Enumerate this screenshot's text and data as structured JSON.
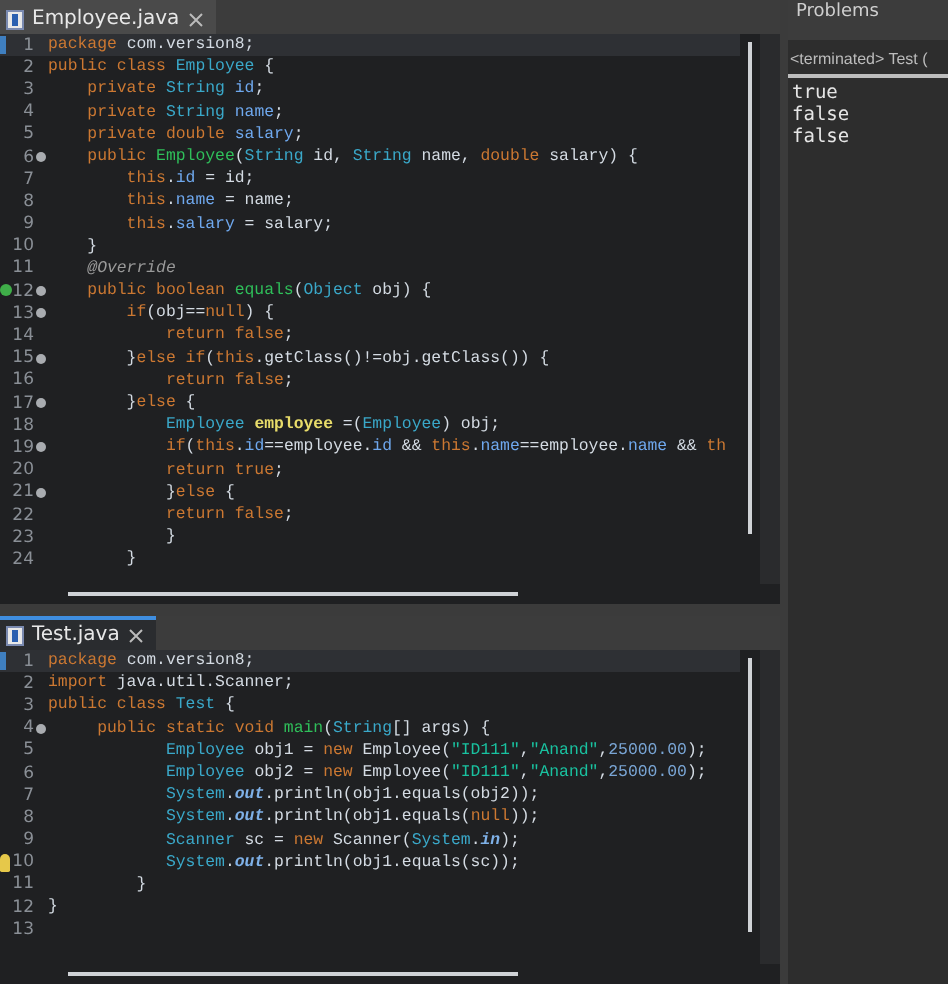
{
  "editors": [
    {
      "tab": {
        "title": "Employee.java",
        "selected": false
      },
      "lines": [
        {
          "number": "1",
          "current": true,
          "fold": false,
          "tokens": [
            {
              "kind": "kw",
              "text": "package"
            },
            {
              "kind": "plain",
              "text": " com.version8;"
            }
          ]
        },
        {
          "number": "2",
          "current": false,
          "fold": false,
          "tokens": [
            {
              "kind": "kw",
              "text": "public class "
            },
            {
              "kind": "type",
              "text": "Employee"
            },
            {
              "kind": "plain",
              "text": " {"
            }
          ]
        },
        {
          "number": "3",
          "current": false,
          "fold": false,
          "tokens": [
            {
              "kind": "kw",
              "text": "    private "
            },
            {
              "kind": "type",
              "text": "String "
            },
            {
              "kind": "field",
              "text": "id"
            },
            {
              "kind": "plain",
              "text": ";"
            }
          ]
        },
        {
          "number": "4",
          "current": false,
          "fold": false,
          "tokens": [
            {
              "kind": "kw",
              "text": "    private "
            },
            {
              "kind": "type",
              "text": "String "
            },
            {
              "kind": "field",
              "text": "name"
            },
            {
              "kind": "plain",
              "text": ";"
            }
          ]
        },
        {
          "number": "5",
          "current": false,
          "fold": false,
          "tokens": [
            {
              "kind": "kw",
              "text": "    private double "
            },
            {
              "kind": "field",
              "text": "salary"
            },
            {
              "kind": "plain",
              "text": ";"
            }
          ]
        },
        {
          "number": "6",
          "current": false,
          "fold": true,
          "tokens": [
            {
              "kind": "kw",
              "text": "    public "
            },
            {
              "kind": "method",
              "text": "Employee"
            },
            {
              "kind": "plain",
              "text": "("
            },
            {
              "kind": "type",
              "text": "String"
            },
            {
              "kind": "plain",
              "text": " id, "
            },
            {
              "kind": "type",
              "text": "String"
            },
            {
              "kind": "plain",
              "text": " name, "
            },
            {
              "kind": "kw",
              "text": "double"
            },
            {
              "kind": "plain",
              "text": " salary) {"
            }
          ]
        },
        {
          "number": "7",
          "current": false,
          "fold": false,
          "tokens": [
            {
              "kind": "kw",
              "text": "        this"
            },
            {
              "kind": "plain",
              "text": "."
            },
            {
              "kind": "field",
              "text": "id"
            },
            {
              "kind": "plain",
              "text": " = id;"
            }
          ]
        },
        {
          "number": "8",
          "current": false,
          "fold": false,
          "tokens": [
            {
              "kind": "kw",
              "text": "        this"
            },
            {
              "kind": "plain",
              "text": "."
            },
            {
              "kind": "field",
              "text": "name"
            },
            {
              "kind": "plain",
              "text": " = name;"
            }
          ]
        },
        {
          "number": "9",
          "current": false,
          "fold": false,
          "tokens": [
            {
              "kind": "kw",
              "text": "        this"
            },
            {
              "kind": "plain",
              "text": "."
            },
            {
              "kind": "field",
              "text": "salary"
            },
            {
              "kind": "plain",
              "text": " = salary;"
            }
          ]
        },
        {
          "number": "10",
          "current": false,
          "fold": false,
          "tokens": [
            {
              "kind": "plain",
              "text": "    }"
            }
          ]
        },
        {
          "number": "11",
          "current": false,
          "fold": false,
          "tokens": [
            {
              "kind": "ann",
              "text": "    @Override"
            }
          ]
        },
        {
          "number": "12",
          "current": false,
          "fold": true,
          "override": true,
          "tokens": [
            {
              "kind": "kw",
              "text": "    public boolean "
            },
            {
              "kind": "method",
              "text": "equals"
            },
            {
              "kind": "plain",
              "text": "("
            },
            {
              "kind": "type",
              "text": "Object"
            },
            {
              "kind": "plain",
              "text": " obj) {"
            }
          ]
        },
        {
          "number": "13",
          "current": false,
          "fold": true,
          "tokens": [
            {
              "kind": "kw",
              "text": "        if"
            },
            {
              "kind": "plain",
              "text": "(obj=="
            },
            {
              "kind": "kw",
              "text": "null"
            },
            {
              "kind": "plain",
              "text": ") {"
            }
          ]
        },
        {
          "number": "14",
          "current": false,
          "fold": false,
          "tokens": [
            {
              "kind": "kw",
              "text": "            return false"
            },
            {
              "kind": "plain",
              "text": ";"
            }
          ]
        },
        {
          "number": "15",
          "current": false,
          "fold": true,
          "tokens": [
            {
              "kind": "plain",
              "text": "        }"
            },
            {
              "kind": "kw",
              "text": "else if"
            },
            {
              "kind": "plain",
              "text": "("
            },
            {
              "kind": "kw",
              "text": "this"
            },
            {
              "kind": "plain",
              "text": ".getClass()!=obj.getClass()) {"
            }
          ]
        },
        {
          "number": "16",
          "current": false,
          "fold": false,
          "tokens": [
            {
              "kind": "kw",
              "text": "            return false"
            },
            {
              "kind": "plain",
              "text": ";"
            }
          ]
        },
        {
          "number": "17",
          "current": false,
          "fold": true,
          "tokens": [
            {
              "kind": "plain",
              "text": "        }"
            },
            {
              "kind": "kw",
              "text": "else"
            },
            {
              "kind": "plain",
              "text": " {"
            }
          ]
        },
        {
          "number": "18",
          "current": false,
          "fold": false,
          "tokens": [
            {
              "kind": "type",
              "text": "            Employee"
            },
            {
              "kind": "local",
              "text": " employee"
            },
            {
              "kind": "plain",
              "text": " =("
            },
            {
              "kind": "type",
              "text": "Employee"
            },
            {
              "kind": "plain",
              "text": ") obj;"
            }
          ]
        },
        {
          "number": "19",
          "current": false,
          "fold": true,
          "tokens": [
            {
              "kind": "kw",
              "text": "            if"
            },
            {
              "kind": "plain",
              "text": "("
            },
            {
              "kind": "kw",
              "text": "this"
            },
            {
              "kind": "plain",
              "text": "."
            },
            {
              "kind": "field",
              "text": "id"
            },
            {
              "kind": "plain",
              "text": "==employee."
            },
            {
              "kind": "field",
              "text": "id"
            },
            {
              "kind": "plain",
              "text": " && "
            },
            {
              "kind": "kw",
              "text": "this"
            },
            {
              "kind": "plain",
              "text": "."
            },
            {
              "kind": "field",
              "text": "name"
            },
            {
              "kind": "plain",
              "text": "==employee."
            },
            {
              "kind": "field",
              "text": "name"
            },
            {
              "kind": "plain",
              "text": " && "
            },
            {
              "kind": "kw",
              "text": "th"
            }
          ]
        },
        {
          "number": "20",
          "current": false,
          "fold": false,
          "tokens": [
            {
              "kind": "kw",
              "text": "            return true"
            },
            {
              "kind": "plain",
              "text": ";"
            }
          ]
        },
        {
          "number": "21",
          "current": false,
          "fold": true,
          "tokens": [
            {
              "kind": "plain",
              "text": "            }"
            },
            {
              "kind": "kw",
              "text": "else"
            },
            {
              "kind": "plain",
              "text": " {"
            }
          ]
        },
        {
          "number": "22",
          "current": false,
          "fold": false,
          "tokens": [
            {
              "kind": "kw",
              "text": "            return false"
            },
            {
              "kind": "plain",
              "text": ";"
            }
          ]
        },
        {
          "number": "23",
          "current": false,
          "fold": false,
          "tokens": [
            {
              "kind": "plain",
              "text": "            }"
            }
          ]
        },
        {
          "number": "24",
          "current": false,
          "fold": false,
          "tokens": [
            {
              "kind": "plain",
              "text": "        }"
            }
          ]
        }
      ]
    },
    {
      "tab": {
        "title": "Test.java",
        "selected": true
      },
      "lines": [
        {
          "number": "1",
          "current": true,
          "fold": false,
          "tokens": [
            {
              "kind": "kw",
              "text": "package"
            },
            {
              "kind": "plain",
              "text": " com.version8;"
            }
          ]
        },
        {
          "number": "2",
          "current": false,
          "fold": false,
          "tokens": [
            {
              "kind": "kw",
              "text": "import"
            },
            {
              "kind": "plain",
              "text": " java.util.Scanner;"
            }
          ]
        },
        {
          "number": "3",
          "current": false,
          "fold": false,
          "tokens": [
            {
              "kind": "kw",
              "text": "public class "
            },
            {
              "kind": "type",
              "text": "Test"
            },
            {
              "kind": "plain",
              "text": " {"
            }
          ]
        },
        {
          "number": "4",
          "current": false,
          "fold": true,
          "tokens": [
            {
              "kind": "kw",
              "text": "     public static void "
            },
            {
              "kind": "method",
              "text": "main"
            },
            {
              "kind": "plain",
              "text": "("
            },
            {
              "kind": "type",
              "text": "String"
            },
            {
              "kind": "plain",
              "text": "[] args) {"
            }
          ]
        },
        {
          "number": "5",
          "current": false,
          "fold": false,
          "tokens": [
            {
              "kind": "type",
              "text": "            Employee"
            },
            {
              "kind": "plain",
              "text": " obj1 = "
            },
            {
              "kind": "kw",
              "text": "new"
            },
            {
              "kind": "plain",
              "text": " Employee("
            },
            {
              "kind": "str",
              "text": "\"ID111\""
            },
            {
              "kind": "plain",
              "text": ","
            },
            {
              "kind": "str",
              "text": "\"Anand\""
            },
            {
              "kind": "plain",
              "text": ","
            },
            {
              "kind": "num",
              "text": "25000.00"
            },
            {
              "kind": "plain",
              "text": ");"
            }
          ]
        },
        {
          "number": "6",
          "current": false,
          "fold": false,
          "tokens": [
            {
              "kind": "type",
              "text": "            Employee"
            },
            {
              "kind": "plain",
              "text": " obj2 = "
            },
            {
              "kind": "kw",
              "text": "new"
            },
            {
              "kind": "plain",
              "text": " Employee("
            },
            {
              "kind": "str",
              "text": "\"ID111\""
            },
            {
              "kind": "plain",
              "text": ","
            },
            {
              "kind": "str",
              "text": "\"Anand\""
            },
            {
              "kind": "plain",
              "text": ","
            },
            {
              "kind": "num",
              "text": "25000.00"
            },
            {
              "kind": "plain",
              "text": ");"
            }
          ]
        },
        {
          "number": "7",
          "current": false,
          "fold": false,
          "tokens": [
            {
              "kind": "type",
              "text": "            System"
            },
            {
              "kind": "plain",
              "text": "."
            },
            {
              "kind": "static",
              "text": "out"
            },
            {
              "kind": "plain",
              "text": ".println(obj1.equals(obj2));"
            }
          ]
        },
        {
          "number": "8",
          "current": false,
          "fold": false,
          "tokens": [
            {
              "kind": "type",
              "text": "            System"
            },
            {
              "kind": "plain",
              "text": "."
            },
            {
              "kind": "static",
              "text": "out"
            },
            {
              "kind": "plain",
              "text": ".println(obj1.equals("
            },
            {
              "kind": "kw",
              "text": "null"
            },
            {
              "kind": "plain",
              "text": "));"
            }
          ]
        },
        {
          "number": "9",
          "current": false,
          "fold": false,
          "tokens": [
            {
              "kind": "type",
              "text": "            Scanner"
            },
            {
              "kind": "plain",
              "text": " sc = "
            },
            {
              "kind": "kw",
              "text": "new"
            },
            {
              "kind": "plain",
              "text": " Scanner("
            },
            {
              "kind": "type",
              "text": "System"
            },
            {
              "kind": "plain",
              "text": "."
            },
            {
              "kind": "static",
              "text": "in"
            },
            {
              "kind": "plain",
              "text": ");"
            }
          ]
        },
        {
          "number": "10",
          "current": false,
          "fold": false,
          "warning": true,
          "tokens": [
            {
              "kind": "type",
              "text": "            System"
            },
            {
              "kind": "plain",
              "text": "."
            },
            {
              "kind": "static",
              "text": "out"
            },
            {
              "kind": "plain",
              "text": ".println(obj1.equals(sc));"
            }
          ]
        },
        {
          "number": "11",
          "current": false,
          "fold": false,
          "tokens": [
            {
              "kind": "plain",
              "text": "         }"
            }
          ]
        },
        {
          "number": "12",
          "current": false,
          "fold": false,
          "tokens": [
            {
              "kind": "plain",
              "text": "}"
            }
          ]
        },
        {
          "number": "13",
          "current": false,
          "fold": false
        }
      ]
    }
  ],
  "side_panel": {
    "tab": "Problems",
    "console_header": "<terminated> Test (",
    "output": [
      "true",
      "false",
      "false"
    ]
  }
}
